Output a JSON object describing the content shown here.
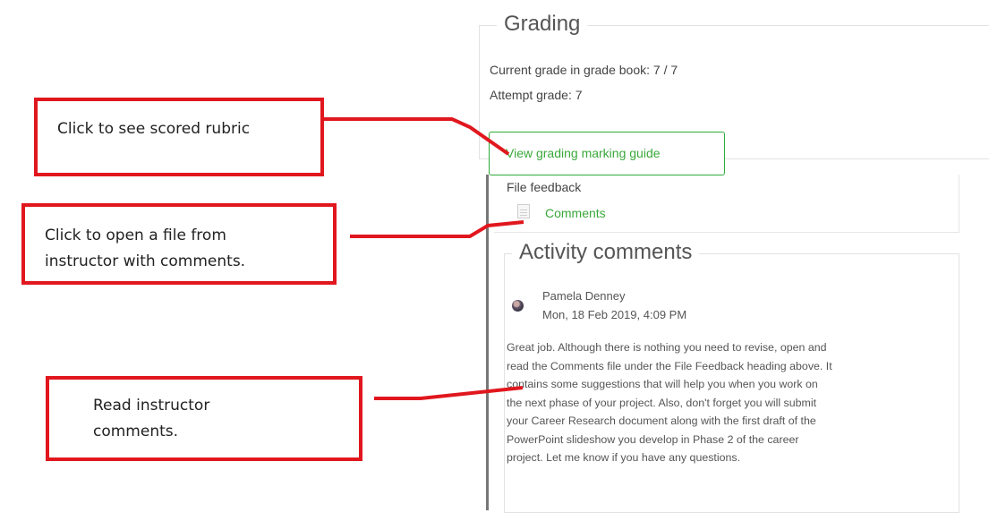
{
  "grading": {
    "legend": "Grading",
    "current_grade": "Current grade in grade book: 7 / 7",
    "attempt_grade": "Attempt grade: 7",
    "view_guide_button": "View grading marking guide"
  },
  "file_feedback": {
    "label": "File feedback",
    "file_icon": "document-icon",
    "file_link": "Comments"
  },
  "activity_comments": {
    "legend": "Activity comments",
    "author": "Pamela Denney",
    "date": "Mon, 18 Feb 2019, 4:09 PM",
    "body_lines": [
      "Great job. Although there is nothing you need to revise, open and",
      "read the Comments file under the File Feedback heading above. It",
      "contains some suggestions that will help you when you work on",
      "the next phase of your project. Also, don't forget you will submit",
      "your Career Research document along with the first draft of the",
      "PowerPoint slideshow you develop in Phase 2 of the career",
      "project. Let me know if you have any questions."
    ]
  },
  "callouts": {
    "rubric": "Click to see scored rubric",
    "file_line1": "Click to open a file from",
    "file_line2": "instructor with comments.",
    "comments_line1": "Read instructor",
    "comments_line2": "comments."
  },
  "colors": {
    "callout_red": "#e1171e",
    "link_green": "#3aa83a"
  }
}
